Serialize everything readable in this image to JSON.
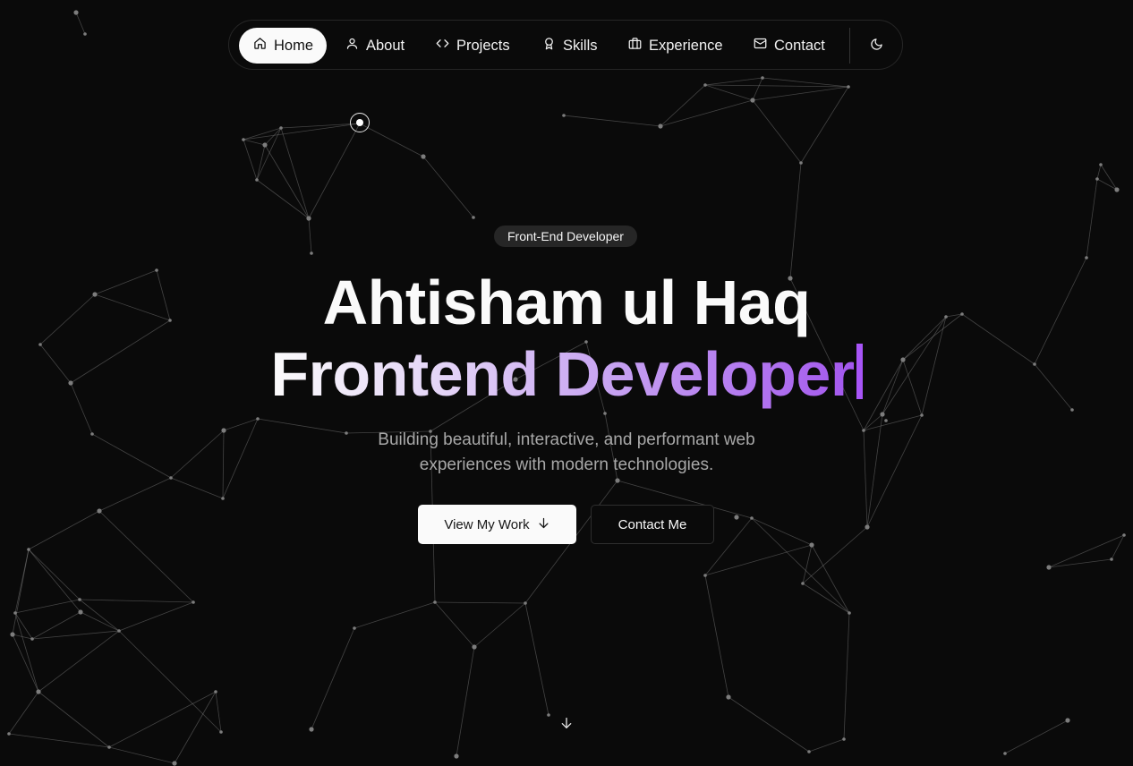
{
  "nav": {
    "items": [
      {
        "label": "Home",
        "icon": "home-icon",
        "active": true
      },
      {
        "label": "About",
        "icon": "user-icon",
        "active": false
      },
      {
        "label": "Projects",
        "icon": "code-icon",
        "active": false
      },
      {
        "label": "Skills",
        "icon": "award-icon",
        "active": false
      },
      {
        "label": "Experience",
        "icon": "briefcase-icon",
        "active": false
      },
      {
        "label": "Contact",
        "icon": "mail-icon",
        "active": false
      }
    ],
    "theme_toggle_icon": "moon-icon"
  },
  "hero": {
    "badge": "Front-End Developer",
    "name": "Ahtisham ul Haq",
    "role": "Frontend Developer",
    "subtitle": "Building beautiful, interactive, and performant web experiences with modern technologies.",
    "primary_button": "View My Work",
    "secondary_button": "Contact Me"
  },
  "colors": {
    "background": "#0a0a0a",
    "accent": "#a855f7",
    "network_line": "#8a8a8a"
  }
}
